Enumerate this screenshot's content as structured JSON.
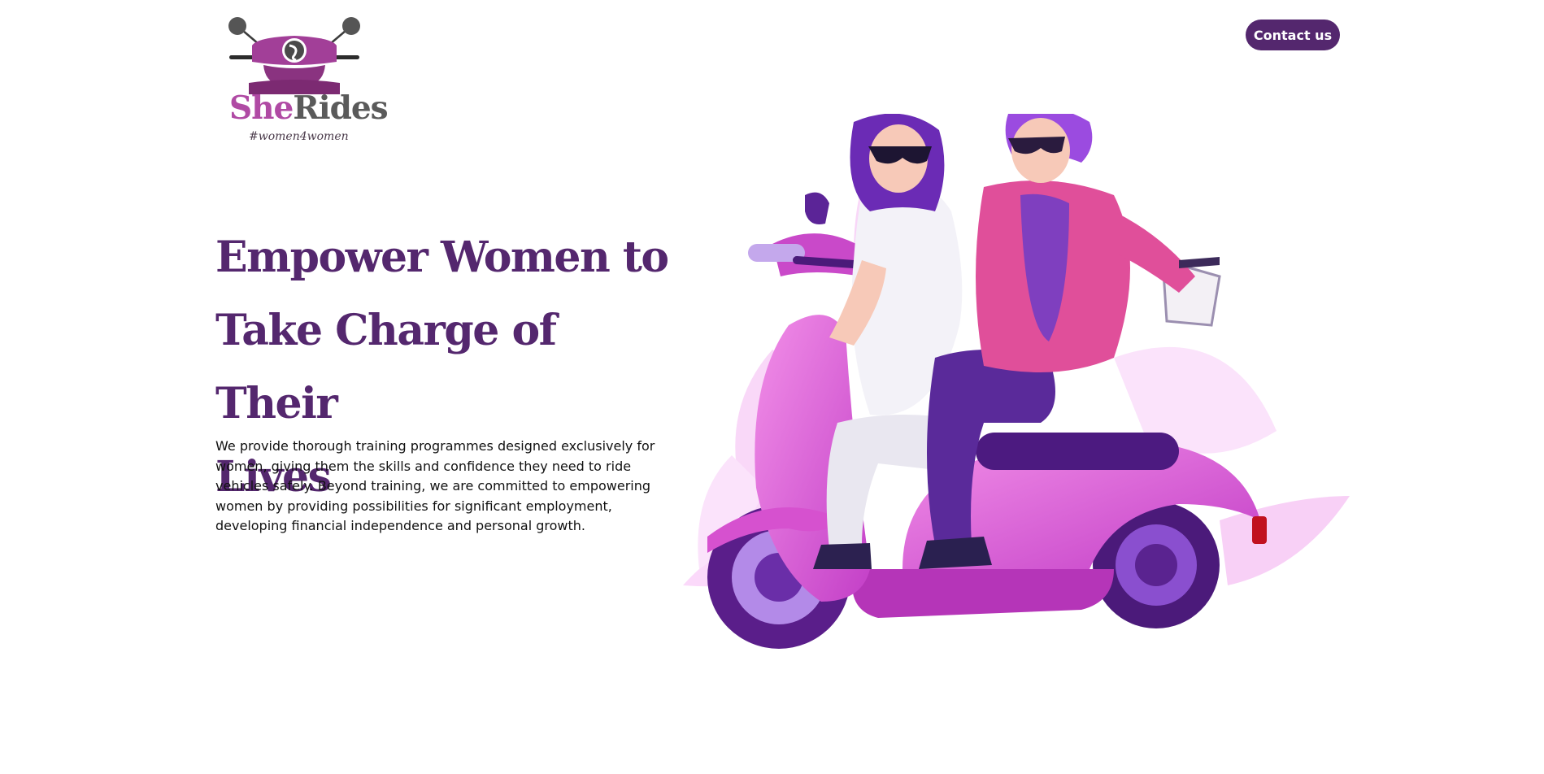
{
  "brand": {
    "name_part1": "She",
    "name_part2": "Rides",
    "tagline": "#women4women",
    "colors": {
      "primary": "#54276e",
      "accent_pink": "#b04aa4",
      "grey": "#5a5a5a"
    }
  },
  "header": {
    "contact_label": "Contact us"
  },
  "hero": {
    "title_line1": "Empower Women to",
    "title_line2": "Take Charge of Their",
    "title_line3": "Lives",
    "description": "We provide thorough training programmes designed exclusively for women, giving them the skills and confidence they need to ride vehicles safely. Beyond training, we are committed to empowering women by providing possibilities for significant employment, developing financial independence and personal growth."
  },
  "icons": {
    "logo_icon": "scooter-front-icon",
    "hero_image": "women-riding-scooter-illustration"
  }
}
